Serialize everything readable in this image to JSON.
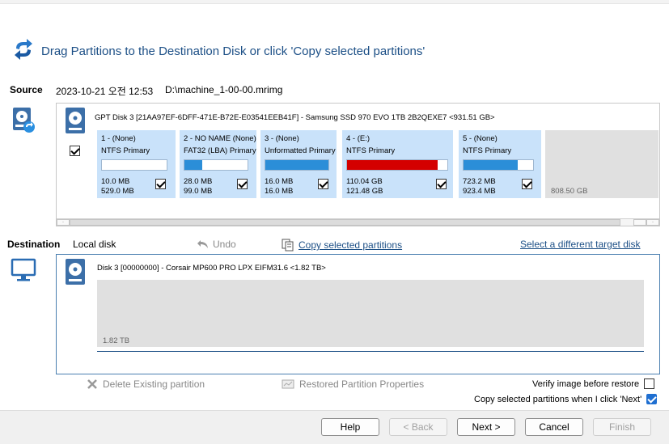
{
  "header": {
    "title": "Drag Partitions to the Destination Disk or click 'Copy selected partitions'"
  },
  "source": {
    "label": "Source",
    "date": "2023-10-21 오전 12:53",
    "path": "D:\\machine_1-00-00.mrimg",
    "disk_title": "GPT Disk 3 [21AA97EF-6DFF-471E-B72E-E03541EEB41F] - Samsung SSD 970 EVO 1TB 2B2QEXE7  <931.51 GB>",
    "partitions": [
      {
        "name": "1 -  (None)",
        "fs": "NTFS Primary",
        "used": "10.0 MB",
        "total": "529.0 MB",
        "fill": 0.0,
        "color": "#2b8ed8",
        "checked": true
      },
      {
        "name": "2 - NO NAME (None)",
        "fs": "FAT32 (LBA) Primary",
        "used": "28.0 MB",
        "total": "99.0 MB",
        "fill": 0.28,
        "color": "#2b8ed8",
        "checked": true
      },
      {
        "name": "3 -  (None)",
        "fs": "Unformatted Primary",
        "used": "16.0 MB",
        "total": "16.0 MB",
        "fill": 1.0,
        "color": "#2b8ed8",
        "checked": true
      },
      {
        "name": "4 -  (E:)",
        "fs": "NTFS Primary",
        "used": "110.04 GB",
        "total": "121.48 GB",
        "fill": 0.906,
        "color": "#d40000",
        "checked": true
      },
      {
        "name": "5 -  (None)",
        "fs": "NTFS Primary",
        "used": "723.2 MB",
        "total": "923.4 MB",
        "fill": 0.78,
        "color": "#2b8ed8",
        "checked": true
      }
    ],
    "unallocated": "808.50 GB"
  },
  "destination": {
    "label": "Destination",
    "local": "Local disk",
    "undo": "Undo",
    "copy_selected": "Copy selected partitions",
    "select_target": "Select a different target disk",
    "disk_title": "Disk 3 [00000000] - Corsair MP600 PRO LPX EIFM31.6  <1.82 TB>",
    "unallocated": "1.82 TB"
  },
  "options": {
    "delete_existing": "Delete Existing partition",
    "restored_props": "Restored Partition Properties",
    "verify": "Verify image before restore",
    "verify_checked": false,
    "copy_when_next": "Copy selected partitions when I click 'Next'",
    "copy_when_next_checked": true
  },
  "footer": {
    "help": "Help",
    "back": "< Back",
    "next": "Next >",
    "cancel": "Cancel",
    "finish": "Finish"
  }
}
